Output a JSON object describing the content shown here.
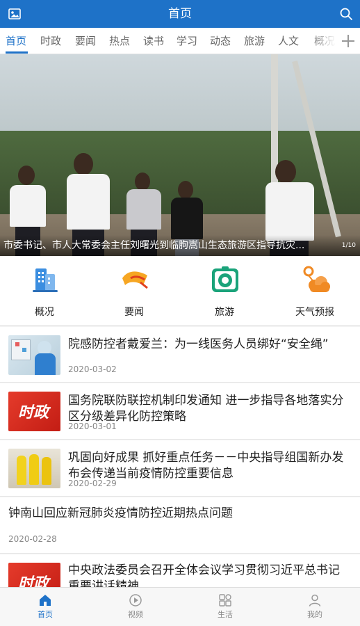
{
  "header": {
    "title": "首页"
  },
  "tabs": [
    "首页",
    "时政",
    "要闻",
    "热点",
    "读书",
    "学习",
    "动态",
    "旅游",
    "人文",
    "概况"
  ],
  "banner": {
    "caption": "市委书记、市人大常委会主任刘曙光到临朐嵩山生态旅游区指导抗灾...",
    "pager": "1/10"
  },
  "quick_links": [
    {
      "label": "概况",
      "icon": "buildings-icon"
    },
    {
      "label": "要闻",
      "icon": "flag-icon"
    },
    {
      "label": "旅游",
      "icon": "camera-icon"
    },
    {
      "label": "天气预报",
      "icon": "weather-icon"
    }
  ],
  "news": [
    {
      "title": "院感防控者戴爱兰：为一线医务人员绑好“安全绳”",
      "date": "2020-03-02"
    },
    {
      "title": "国务院联防联控机制印发通知 进一步指导各地落实分区分级差异化防控策略",
      "date": "2020-03-01",
      "thumb_text": "时政"
    },
    {
      "title": "巩固向好成果 抓好重点任务－－中央指导组国新办发布会传递当前疫情防控重要信息",
      "date": "2020-02-29"
    },
    {
      "title": "钟南山回应新冠肺炎疫情防控近期热点问题",
      "date": "2020-02-28"
    },
    {
      "title": "中央政法委员会召开全体会议学习贯彻习近平总书记重要讲话精神",
      "date": "",
      "thumb_text": "时政"
    }
  ],
  "bottom_nav": [
    {
      "label": "首页",
      "icon": "home-icon"
    },
    {
      "label": "视频",
      "icon": "video-icon"
    },
    {
      "label": "生活",
      "icon": "life-icon"
    },
    {
      "label": "我的",
      "icon": "profile-icon"
    }
  ],
  "colors": {
    "primary": "#1e72c8",
    "shizheng_red": "#d42a1f"
  }
}
